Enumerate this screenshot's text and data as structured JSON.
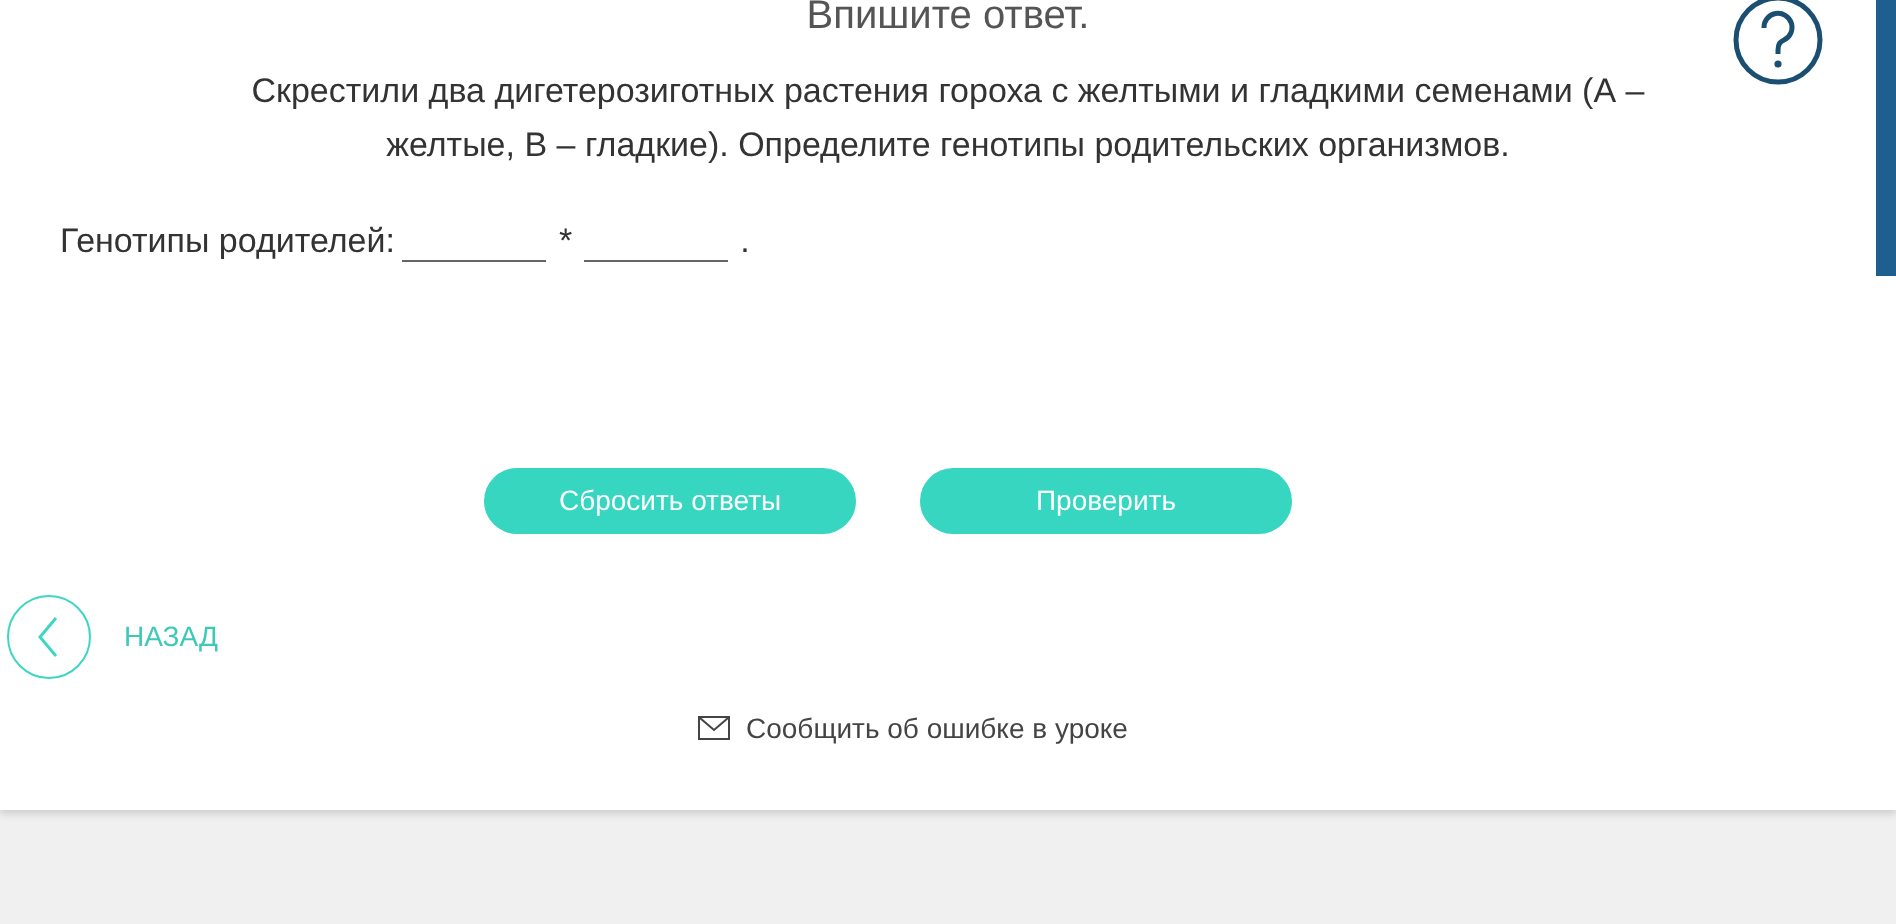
{
  "heading": "Впишите ответ.",
  "question": "Скрестили два дигетерозиготных растения гороха с желтыми и гладкими семенами (А – желтые, В – гладкие). Определите генотипы родительских организмов.",
  "answer": {
    "label": "Генотипы родителей:",
    "fields": [
      {
        "kind": "blank"
      },
      {
        "kind": "blank"
      }
    ],
    "separator": "*",
    "end": "."
  },
  "buttons": [
    {
      "label": "Сбросить ответы"
    },
    {
      "label": "Проверить"
    }
  ],
  "back": {
    "label": "НАЗАД"
  },
  "report": {
    "label": "Сообщить об ошибке в уроке"
  }
}
